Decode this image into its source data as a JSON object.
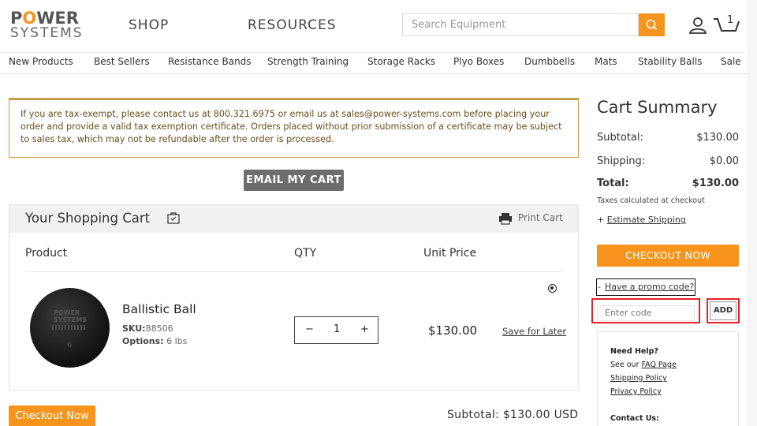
{
  "header": {
    "logo_line1_pre": "P",
    "logo_line1_o": "O",
    "logo_line1_post": "WER",
    "logo_line2": "SYSTEMS",
    "nav_shop": "SHOP",
    "nav_resources": "RESOURCES",
    "search_placeholder": "Search Equipment",
    "cart_count": "1"
  },
  "categories": [
    "New Products",
    "Best Sellers",
    "Resistance Bands",
    "Strength Training",
    "Storage Racks",
    "Plyo Boxes",
    "Dumbbells",
    "Mats",
    "Stability Balls",
    "Sale"
  ],
  "notice": {
    "text": "If you are tax-exempt, please contact us at 800.321.6975 or email us at sales@power-systems.com before placing your order and provide a valid tax exemption certificate. Orders placed without prior submission of a certificate may be subject to sales tax, which may not be refundable after the order is processed."
  },
  "email_cart_label": "EMAIL MY CART",
  "cart": {
    "title": "Your Shopping Cart",
    "print_label": "Print Cart",
    "col_product": "Product",
    "col_qty": "QTY",
    "col_unit_price": "Unit Price",
    "item": {
      "name": "Ballistic Ball",
      "sku_label": "SKU:",
      "sku": "88506",
      "options_label": "Options:",
      "options": "6 lbs",
      "qty": "1",
      "qty_minus": "−",
      "qty_plus": "+",
      "price": "$130.00",
      "save_later": "Save for Later",
      "image_brand": "POWER SYSTEMS",
      "image_weight": "6"
    },
    "checkout_label": "Checkout Now",
    "subtotal_text": "Subtotal: $130.00 USD"
  },
  "summary": {
    "title": "Cart Summary",
    "subtotal_label": "Subtotal:",
    "subtotal_value": "$130.00",
    "shipping_label": "Shipping:",
    "shipping_value": "$0.00",
    "total_label": "Total:",
    "total_value": "$130.00",
    "taxes_note": "Taxes calculated at checkout",
    "est_ship_prefix": "+",
    "est_ship_link": "Estimate Shipping",
    "checkout_label": "CHECKOUT NOW",
    "promo_dash": "-",
    "promo_link": "Have a promo code?",
    "promo_placeholder": "Enter code",
    "promo_add": "ADD"
  },
  "help": {
    "title": "Need Help?",
    "see_our": "See our",
    "faq": "FAQ Page",
    "shipping_policy": "Shipping Policy",
    "privacy_policy": "Privacy Policy",
    "contact": "Contact Us:"
  },
  "colors": {
    "accent_orange": "#f7941d",
    "notice_border": "#c89c4a",
    "highlight_red": "#e5202a"
  }
}
